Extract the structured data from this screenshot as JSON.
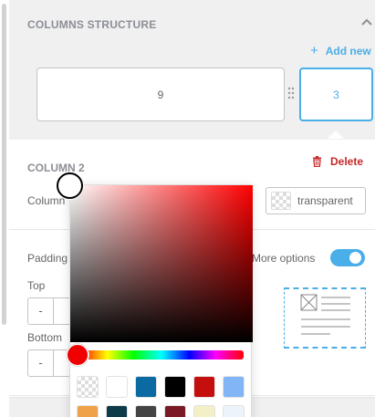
{
  "columns_structure": {
    "title": "COLUMNS STRUCTURE",
    "add_new_label": "Add new",
    "columns": [
      {
        "value": "9",
        "selected": false
      },
      {
        "value": "3",
        "selected": true
      }
    ]
  },
  "column_settings": {
    "header": "COLUMN 2",
    "delete_label": "Delete",
    "color_field_label": "Column",
    "color_value": "transparent"
  },
  "padding": {
    "label": "Padding",
    "more_options_label": "More options",
    "more_options_enabled": true,
    "top_label": "Top",
    "bottom_label": "Bottom",
    "decrement_symbol": "-"
  },
  "color_picker": {
    "selected_hue_color": "#ff0000",
    "preset_colors": [
      "transparent",
      "#ffffff",
      "#0a6aa1",
      "#000000",
      "#c50e0e",
      "#82b5f5",
      "#f0a24a",
      "#0d3b48",
      "#444444",
      "#7a1a25",
      "#f3efc6",
      "#ecf3fb"
    ]
  },
  "colors": {
    "accent": "#4aaee8",
    "danger": "#c62828",
    "muted_text": "#8c8f94",
    "panel_bg": "#f0f0f1"
  }
}
